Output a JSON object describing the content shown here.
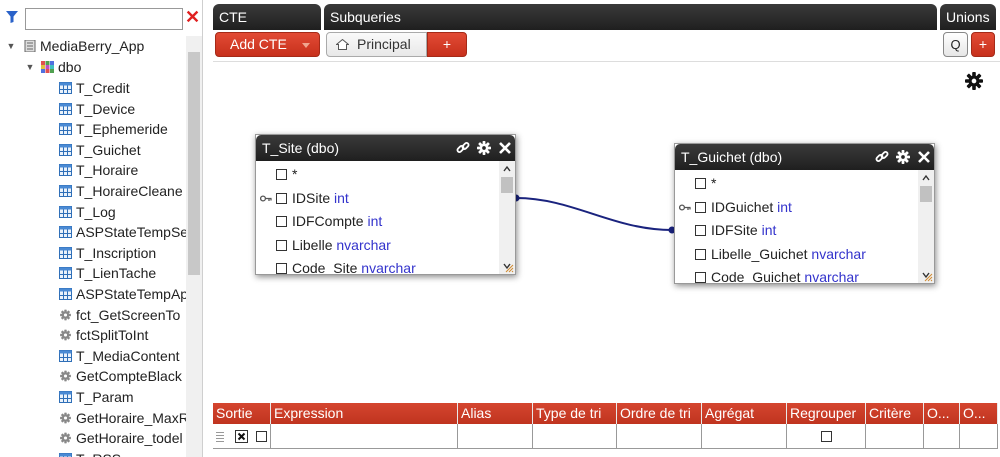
{
  "filter": {
    "value": "",
    "placeholder": ""
  },
  "tree": {
    "root": "MediaBerry_App",
    "schema": "dbo",
    "items": [
      {
        "label": "T_Credit",
        "icon": "table-icon"
      },
      {
        "label": "T_Device",
        "icon": "table-icon"
      },
      {
        "label": "T_Ephemeride",
        "icon": "table-icon"
      },
      {
        "label": "T_Guichet",
        "icon": "table-icon"
      },
      {
        "label": "T_Horaire",
        "icon": "table-icon"
      },
      {
        "label": "T_HoraireCleane",
        "icon": "table-icon"
      },
      {
        "label": "T_Log",
        "icon": "table-icon"
      },
      {
        "label": "ASPStateTempSe",
        "icon": "table-icon"
      },
      {
        "label": "T_Inscription",
        "icon": "table-icon"
      },
      {
        "label": "T_LienTache",
        "icon": "table-icon"
      },
      {
        "label": "ASPStateTempAp",
        "icon": "table-icon"
      },
      {
        "label": "fct_GetScreenTo",
        "icon": "function-icon"
      },
      {
        "label": "fctSplitToInt",
        "icon": "function-icon"
      },
      {
        "label": "T_MediaContent",
        "icon": "table-icon"
      },
      {
        "label": "GetCompteBlack",
        "icon": "function-icon"
      },
      {
        "label": "T_Param",
        "icon": "table-icon"
      },
      {
        "label": "GetHoraire_MaxR",
        "icon": "function-icon"
      },
      {
        "label": "GetHoraire_todel",
        "icon": "function-icon"
      },
      {
        "label": "T_RSS",
        "icon": "table-icon"
      }
    ]
  },
  "tabs": {
    "cte": "CTE",
    "subqueries": "Subqueries",
    "unions": "Unions"
  },
  "toolbar": {
    "add_cte": "Add CTE",
    "principal": "Principal",
    "add_subquery": "+",
    "q": "Q",
    "add_union": "+"
  },
  "tables": [
    {
      "title": "T_Site (dbo)",
      "columns": [
        {
          "name": "*",
          "type": "",
          "key": false
        },
        {
          "name": "IDSite",
          "type": "int",
          "key": true
        },
        {
          "name": "IDFCompte",
          "type": "int",
          "key": false
        },
        {
          "name": "Libelle",
          "type": "nvarchar",
          "key": false
        },
        {
          "name": "Code_Site",
          "type": "nvarchar",
          "key": false
        }
      ]
    },
    {
      "title": "T_Guichet (dbo)",
      "columns": [
        {
          "name": "*",
          "type": "",
          "key": false
        },
        {
          "name": "IDGuichet",
          "type": "int",
          "key": true
        },
        {
          "name": "IDFSite",
          "type": "int",
          "key": false
        },
        {
          "name": "Libelle_Guichet",
          "type": "nvarchar",
          "key": false
        },
        {
          "name": "Code_Guichet",
          "type": "nvarchar",
          "key": false
        }
      ]
    }
  ],
  "grid": {
    "headers": [
      "Sortie",
      "Expression",
      "Alias",
      "Type de tri",
      "Ordre de tri",
      "Agrégat",
      "Regrouper",
      "Critère",
      "O...",
      "O..."
    ]
  },
  "colors": {
    "accent_red": "#c7301c",
    "header_dark": "#262626",
    "type_blue": "#3333cc",
    "link_line": "#1a237e"
  }
}
